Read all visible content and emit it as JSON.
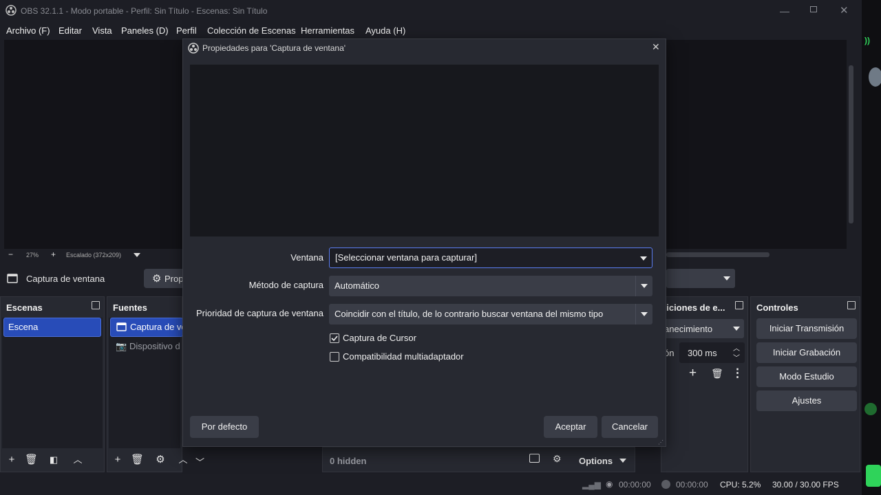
{
  "window": {
    "title": "OBS 32.1.1 - Modo portable - Perfil: Sin Título - Escenas: Sin Título"
  },
  "menu": [
    "Archivo (F)",
    "Editar",
    "Vista",
    "Paneles (D)",
    "Perfil",
    "Colección de Escenas",
    "Herramientas",
    "Ayuda (H)"
  ],
  "zoom": {
    "value": "27%",
    "scaled": "Escalado (372x209)"
  },
  "source_toolbar": {
    "source_name": "Captura de ventana",
    "properties_label": "Prop",
    "transition_visible": "anecimiento",
    "duration_label": "ón",
    "duration_value": "300 ms"
  },
  "docks": {
    "scenes": {
      "title": "Escenas",
      "items": [
        "Escena"
      ]
    },
    "sources": {
      "title": "Fuentes",
      "items": [
        "Captura de ve",
        "Dispositivo d"
      ]
    },
    "transitions": {
      "title": "siciones de e..."
    },
    "controls": {
      "title": "Controles",
      "buttons": [
        "Iniciar Transmisión",
        "Iniciar Grabación",
        "Modo Estudio",
        "Ajustes"
      ]
    }
  },
  "mixer": {
    "hidden_label": "0 hidden",
    "options_label": "Options"
  },
  "status": {
    "stream_time": "00:00:00",
    "rec_time": "00:00:00",
    "cpu": "CPU: 5.2%",
    "fps": "30.00 / 30.00 FPS"
  },
  "dialog": {
    "title": "Propiedades para 'Captura de ventana'",
    "fields": [
      {
        "label": "Ventana",
        "value": "[Seleccionar ventana para capturar]"
      },
      {
        "label": "Método de captura",
        "value": "Automático"
      },
      {
        "label": "Prioridad de captura de ventana",
        "value": "Coincidir con el título, de lo contrario buscar ventana del mismo tipo"
      }
    ],
    "checkboxes": [
      {
        "label": "Captura de Cursor",
        "checked": true
      },
      {
        "label": "Compatibilidad multiadaptador",
        "checked": false
      }
    ],
    "defaults_button": "Por defecto",
    "ok_button": "Aceptar",
    "cancel_button": "Cancelar"
  },
  "colors": {
    "accent": "#284cb8",
    "focus_border": "#5a7cf0",
    "panel": "#272931",
    "background": "#1d1e25"
  }
}
